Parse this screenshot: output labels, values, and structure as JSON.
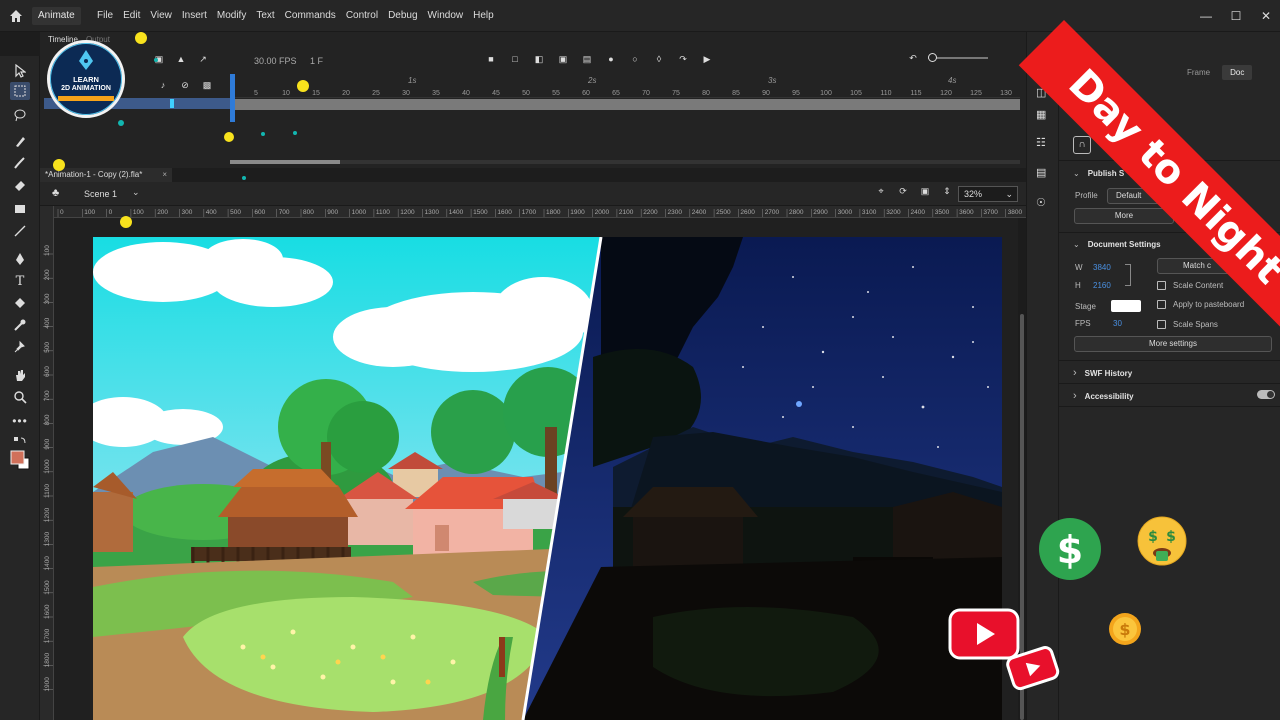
{
  "app": {
    "tab_label": "Animate"
  },
  "menu": [
    "File",
    "Edit",
    "View",
    "Insert",
    "Modify",
    "Text",
    "Commands",
    "Control",
    "Debug",
    "Window",
    "Help"
  ],
  "timeline": {
    "tabs": [
      "Timeline",
      "Output"
    ],
    "fps": "30.00",
    "fps_unit": "FPS",
    "frame": "1",
    "frame_unit": "F",
    "seconds": [
      "1s",
      "2s",
      "3s",
      "4s"
    ],
    "frames": [
      "5",
      "10",
      "15",
      "20",
      "25",
      "30",
      "35",
      "40",
      "45",
      "50",
      "55",
      "60",
      "65",
      "70",
      "75",
      "80",
      "85",
      "90",
      "95",
      "100",
      "105",
      "110",
      "115",
      "120",
      "125",
      "130"
    ]
  },
  "document": {
    "tab_title": "*Animation-1 - Copy (2).fla*",
    "close": "×",
    "scene": "Scene 1",
    "zoom": "32%"
  },
  "ruler": {
    "h": [
      "0",
      "100",
      "0",
      "100",
      "200",
      "300",
      "400",
      "500",
      "600",
      "700",
      "800",
      "900",
      "1000",
      "1100",
      "1200",
      "1300",
      "1400",
      "1500",
      "1600",
      "1700",
      "1800",
      "1900",
      "2000",
      "2100",
      "2200",
      "2300",
      "2400",
      "2500",
      "2600",
      "2700",
      "2800",
      "2900",
      "3000",
      "3100",
      "3200",
      "2400",
      "3500",
      "3600",
      "3700",
      "3800"
    ],
    "v": [
      "100",
      "200",
      "300",
      "400",
      "500",
      "600",
      "700",
      "800",
      "900",
      "1000",
      "1100",
      "1200",
      "1300",
      "1400",
      "1500",
      "1600",
      "1700",
      "1800",
      "1900"
    ]
  },
  "properties": {
    "tabs": [
      "Frame",
      "Doc"
    ],
    "publish_heading": "Publish S",
    "profile_label": "Profile",
    "profile_value": "Default",
    "more_button": "More",
    "doc_settings_heading": "Document Settings",
    "w_label": "W",
    "w_value": "3840",
    "h_label": "H",
    "h_value": "2160",
    "match_button": "Match c",
    "scale_content": "Scale Content",
    "stage_label": "Stage",
    "apply_pasteboard": "Apply to pasteboard",
    "fps_label": "FPS",
    "fps_value": "30",
    "scale_spans": "Scale Spans",
    "more_settings": "More settings",
    "swf_history": "SWF History",
    "accessibility": "Accessibility"
  },
  "overlay": {
    "banner": "Day to Night",
    "logo_line1": "LEARN",
    "logo_line2": "2D ANIMATION"
  },
  "colors": {
    "accent": "#2f7bd8",
    "banner": "#ec1c1c",
    "dollar_green": "#2ea44f",
    "youtube_red": "#e8102b"
  }
}
